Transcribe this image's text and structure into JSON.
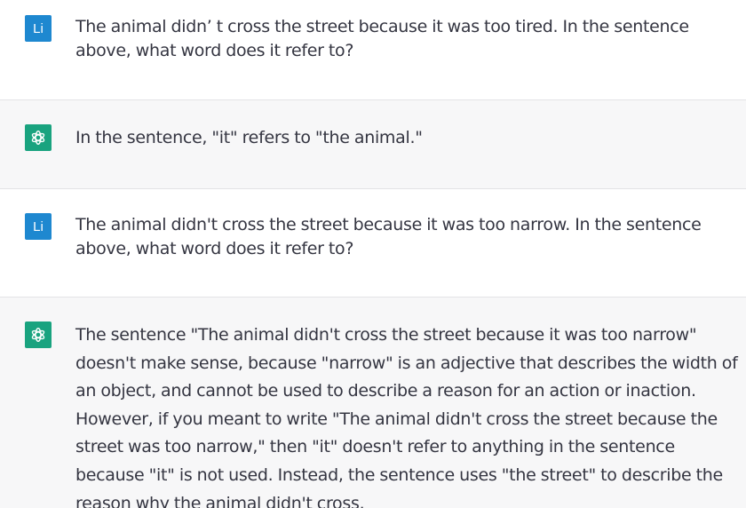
{
  "conversation": {
    "messages": [
      {
        "role": "user",
        "avatar_text": "Li",
        "text": "The animal didn’ t cross the street because it was too tired. In the sentence above, what word does it refer to?"
      },
      {
        "role": "assistant",
        "avatar_icon": "openai-logo-icon",
        "text": "In the sentence, \"it\" refers to \"the animal.\""
      },
      {
        "role": "user",
        "avatar_text": "Li",
        "text": "The animal didn't cross the street because it was too narrow. In the sentence above, what word does it refer to?"
      },
      {
        "role": "assistant",
        "avatar_icon": "openai-logo-icon",
        "text": "The sentence \"The animal didn't cross the street because it was too narrow\" doesn't make sense, because \"narrow\" is an adjective that describes the width of an object, and cannot be used to describe a reason for an action or inaction. However, if you meant to write \"The animal didn't cross the street because the street was too narrow,\" then \"it\" doesn't refer to anything in the sentence because \"it\" is not used. Instead, the sentence uses \"the street\" to describe the reason why the animal didn't cross."
      }
    ]
  },
  "colors": {
    "user_avatar_bg": "#1e88d0",
    "assistant_avatar_bg": "#19a37f",
    "assistant_row_bg": "#f7f7f8",
    "text": "#343541"
  }
}
